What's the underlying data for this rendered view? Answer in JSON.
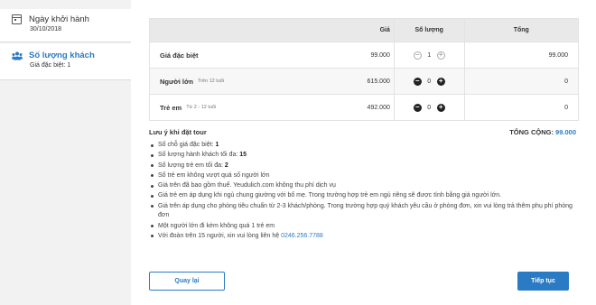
{
  "sidebar": {
    "step1": {
      "title": "Ngày khởi hành",
      "sub": "30/10/2018",
      "icon": "calendar-icon"
    },
    "step2": {
      "title": "Số lượng khách",
      "sub": "Giá đặc biệt: 1",
      "icon": "users-icon"
    }
  },
  "table": {
    "headers": {
      "price": "Giá",
      "qty": "Số lượng",
      "total": "Tổng"
    },
    "rows": [
      {
        "name": "Giá đặc biệt",
        "hint": "",
        "price": "99.000",
        "qty": "1",
        "total": "99.000"
      },
      {
        "name": "Người lớn",
        "hint": "Trên 12 tuổi",
        "price": "615.000",
        "qty": "0",
        "total": "0"
      },
      {
        "name": "Trẻ em",
        "hint": "Từ 2 - 12 tuổi",
        "price": "492.000",
        "qty": "0",
        "total": "0"
      }
    ]
  },
  "notes": {
    "title": "Lưu ý khi đặt tour",
    "total_label": "TỔNG CỘNG:",
    "total_value": "99.000",
    "items": {
      "n1": "Số chỗ giá đặc biệt: ",
      "n1b": "1",
      "n2": "Số lượng hành khách tối đa: ",
      "n2b": "15",
      "n3": "Số lượng trẻ em tối đa: ",
      "n3b": "2",
      "n4": "Số trẻ em không vượt quá số người lớn",
      "n5": "Giá trên đã bao gồm thuế. Yeudulich.com không thu phí dịch vụ",
      "n6": "Giá trẻ em áp dụng khi ngủ chung giường với bố mẹ. Trong trường hợp trẻ em ngủ riêng sẽ được tính bằng giá người lớn.",
      "n7": "Giá trên áp dụng cho phòng tiêu chuẩn từ 2-3 khách/phòng. Trong trường hợp quý khách yêu cầu ở phòng đơn, xin vui lòng trả thêm phụ phí phòng đơn",
      "n8": "Một người lớn đi kèm không quá 1 trẻ em",
      "n9": "Với đoàn trên 15 người, xin vui lòng liên hệ ",
      "n9link": "0246.256.7788"
    }
  },
  "buttons": {
    "back": "Quay lại",
    "next": "Tiếp tục"
  },
  "colors": {
    "accent": "#2b7bc4"
  }
}
